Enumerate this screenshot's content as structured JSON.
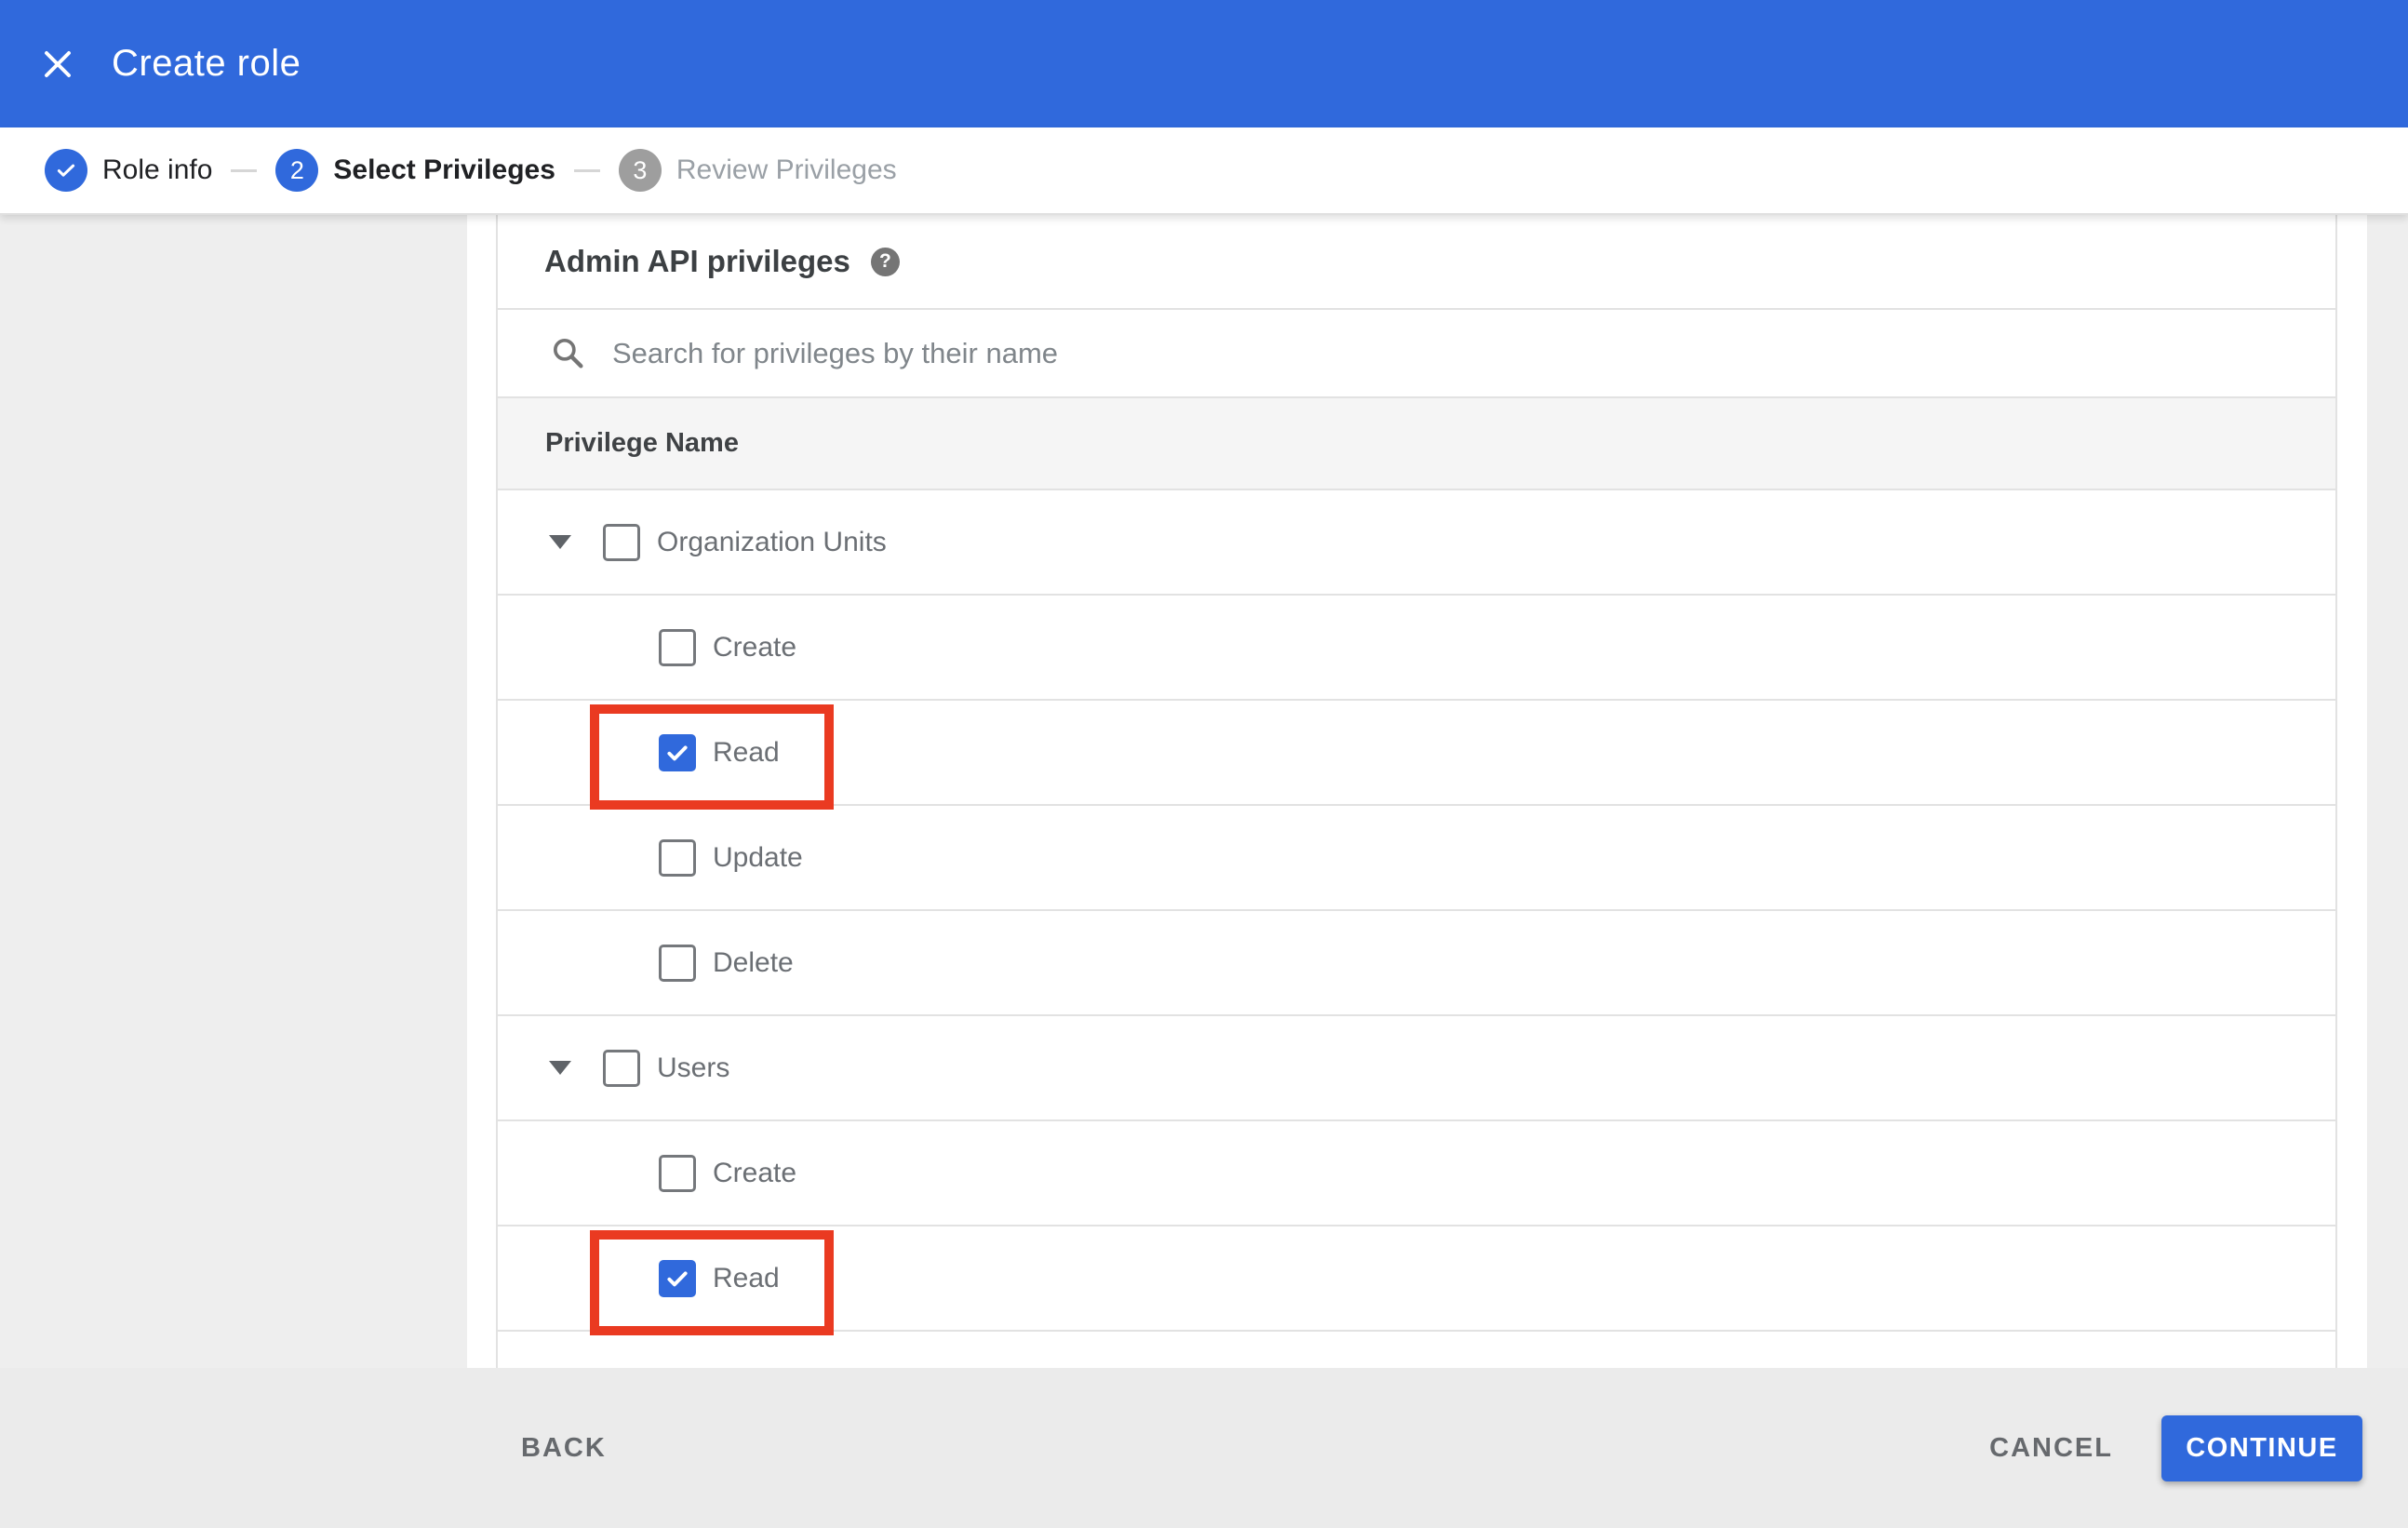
{
  "header": {
    "title": "Create role"
  },
  "stepper": {
    "steps": [
      {
        "number": "1",
        "label": "Role info",
        "state": "completed"
      },
      {
        "number": "2",
        "label": "Select Privileges",
        "state": "active"
      },
      {
        "number": "3",
        "label": "Review Privileges",
        "state": "upcoming"
      }
    ]
  },
  "content": {
    "section_title": "Admin API privileges",
    "help_icon": "question-mark-circle-icon",
    "search": {
      "placeholder": "Search for privileges by their name",
      "value": "",
      "icon": "search-icon"
    },
    "table": {
      "column_header": "Privilege Name",
      "rows": [
        {
          "label": "Organization Units",
          "type": "parent",
          "expanded": true,
          "checked": false,
          "highlighted": false
        },
        {
          "label": "Create",
          "type": "child",
          "checked": false,
          "highlighted": false
        },
        {
          "label": "Read",
          "type": "child",
          "checked": true,
          "highlighted": true
        },
        {
          "label": "Update",
          "type": "child",
          "checked": false,
          "highlighted": false
        },
        {
          "label": "Delete",
          "type": "child",
          "checked": false,
          "highlighted": false
        },
        {
          "label": "Users",
          "type": "parent",
          "expanded": true,
          "checked": false,
          "highlighted": false
        },
        {
          "label": "Create",
          "type": "child",
          "checked": false,
          "highlighted": false
        },
        {
          "label": "Read",
          "type": "child",
          "checked": true,
          "highlighted": true
        }
      ]
    }
  },
  "footer": {
    "back_label": "BACK",
    "cancel_label": "CANCEL",
    "continue_label": "CONTINUE"
  },
  "colors": {
    "primary_blue": "#3069dc",
    "step_inactive_gray": "#9e9e9e",
    "highlight_red": "#ea3a21",
    "column_header_bg": "#f5f5f5"
  }
}
